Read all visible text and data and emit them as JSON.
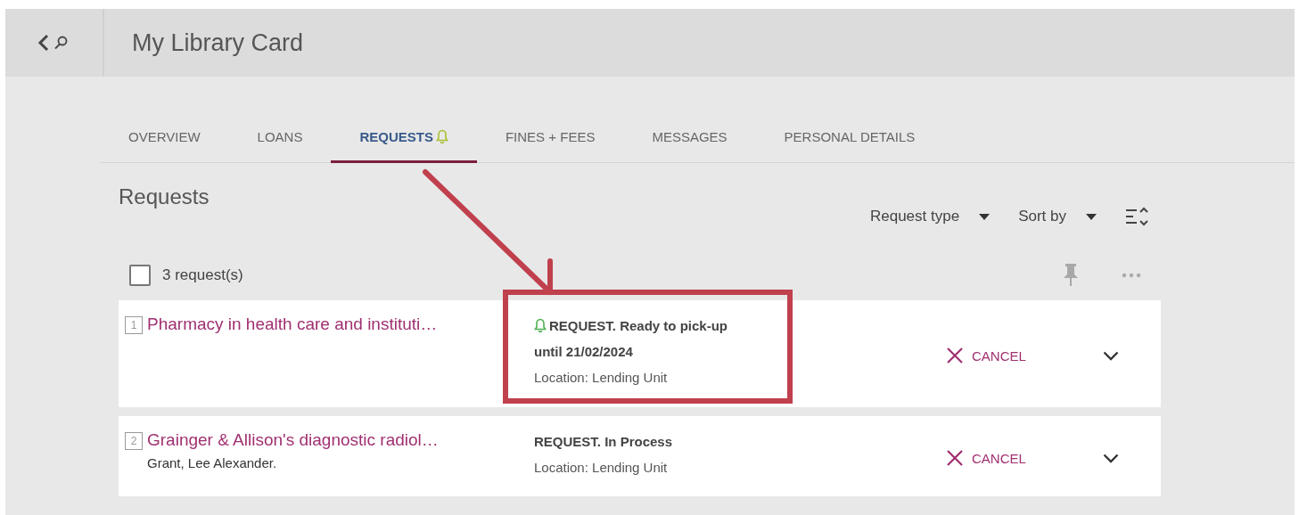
{
  "header": {
    "title": "My Library Card"
  },
  "tabs": [
    {
      "label": "OVERVIEW",
      "selected": false,
      "notified": false
    },
    {
      "label": "LOANS",
      "selected": false,
      "notified": false
    },
    {
      "label": "REQUESTS",
      "selected": true,
      "notified": true
    },
    {
      "label": "FINES + FEES",
      "selected": false,
      "notified": false
    },
    {
      "label": "MESSAGES",
      "selected": false,
      "notified": false
    },
    {
      "label": "PERSONAL DETAILS",
      "selected": false,
      "notified": false
    }
  ],
  "section": {
    "title": "Requests",
    "filters": [
      "Request type",
      "Sort by"
    ]
  },
  "list": {
    "select_all": {
      "checked": false,
      "label": "3 request(s)"
    },
    "rows": [
      {
        "number": "1",
        "title": "Pharmacy in health care and instituti…",
        "author": "",
        "status": [
          "REQUEST. Ready to pick-up",
          "until 21/02/2024"
        ],
        "location": "Location: Lending Unit",
        "notified": true,
        "highlighted": true,
        "action": "CANCEL"
      },
      {
        "number": "2",
        "title": "Grainger & Allison's diagnostic radiol…",
        "author": "Grant, Lee Alexander.",
        "status": [
          "REQUEST. In Process"
        ],
        "location": "Location: Lending Unit",
        "notified": false,
        "highlighted": false,
        "action": "CANCEL"
      }
    ]
  }
}
